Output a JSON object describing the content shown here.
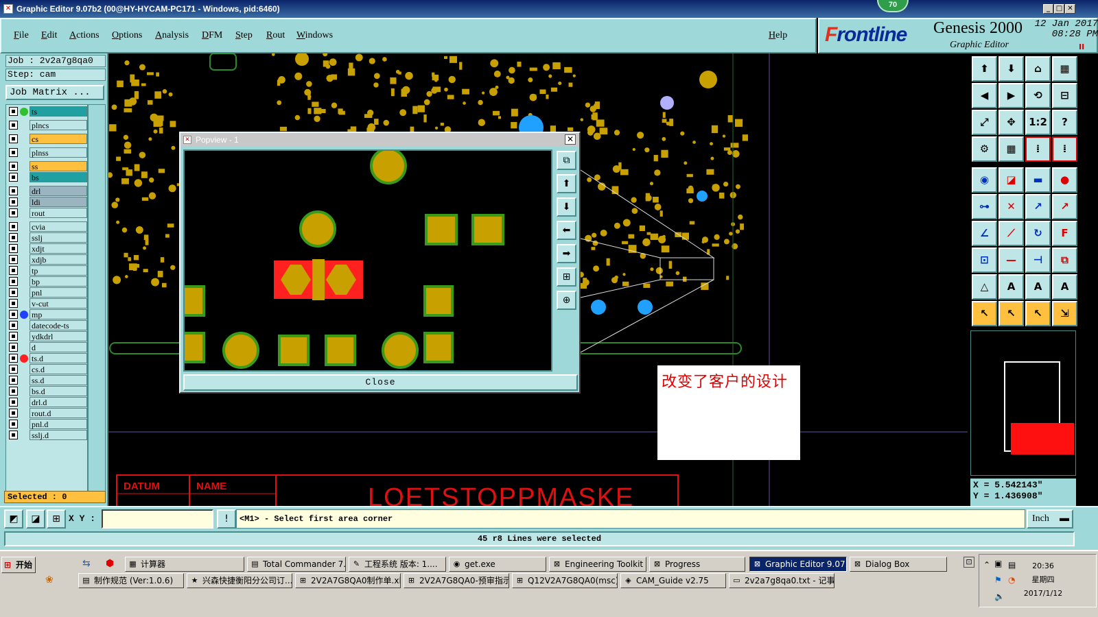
{
  "window": {
    "title": "Graphic Editor 9.07b2 (00@HY-HYCAM-PC171 - Windows, pid:6460)",
    "badge": "70"
  },
  "menu": {
    "items": [
      "File",
      "Edit",
      "Actions",
      "Options",
      "Analysis",
      "DFM",
      "Step",
      "Rout",
      "Windows"
    ],
    "help": "Help"
  },
  "brand": {
    "logo_f": "F",
    "logo_rest": "rontline",
    "title": "Genesis 2000",
    "subtitle": "Graphic Editor",
    "date": "12 Jan 2017",
    "time": "08:28 PM",
    "pause": "II"
  },
  "job": {
    "job": "Job : 2v2a7g8qa0",
    "step": "Step: cam",
    "matrix": "Job Matrix ..."
  },
  "layers": [
    {
      "name": "ts",
      "color": "#20a0a0",
      "dot": "#30c030"
    },
    {
      "name": "plncs",
      "color": "#bfe6e6"
    },
    {
      "name": "cs",
      "color": "#ffc040",
      "mark": "✎"
    },
    {
      "name": "plnss",
      "color": "#bfe6e6"
    },
    {
      "name": "ss",
      "color": "#ffc040",
      "mark": "✎"
    },
    {
      "name": "bs",
      "color": "#20a0a0"
    },
    {
      "name": "drl",
      "color": "#9ab4c0"
    },
    {
      "name": "ldi",
      "color": "#9ab4c0"
    },
    {
      "name": "rout",
      "color": "#bfe6e6"
    },
    {
      "name": "cvia",
      "color": "#bfe6e6"
    },
    {
      "name": "sslj",
      "color": "#bfe6e6",
      "mark": "✎"
    },
    {
      "name": "xdjt",
      "color": "#bfe6e6"
    },
    {
      "name": "xdjb",
      "color": "#bfe6e6"
    },
    {
      "name": "tp",
      "color": "#bfe6e6"
    },
    {
      "name": "bp",
      "color": "#bfe6e6"
    },
    {
      "name": "pnl",
      "color": "#bfe6e6",
      "mark": "✎"
    },
    {
      "name": "v-cut",
      "color": "#bfe6e6"
    },
    {
      "name": "mp",
      "color": "#bfe6e6",
      "dot": "#2040ff"
    },
    {
      "name": "datecode-ts",
      "color": "#bfe6e6"
    },
    {
      "name": "ydkdrl",
      "color": "#bfe6e6"
    },
    {
      "name": "d",
      "color": "#bfe6e6"
    },
    {
      "name": "ts.d",
      "color": "#bfe6e6",
      "dot": "#ff2020",
      "mark": "▪"
    },
    {
      "name": "cs.d",
      "color": "#bfe6e6",
      "mark": "✎"
    },
    {
      "name": "ss.d",
      "color": "#bfe6e6",
      "mark": "✎"
    },
    {
      "name": "bs.d",
      "color": "#bfe6e6"
    },
    {
      "name": "drl.d",
      "color": "#bfe6e6"
    },
    {
      "name": "rout.d",
      "color": "#bfe6e6"
    },
    {
      "name": "pnl.d",
      "color": "#bfe6e6",
      "mark": "✎"
    },
    {
      "name": "sslj.d",
      "color": "#bfe6e6",
      "mark": "✎"
    }
  ],
  "selected": "Selected : 0",
  "popview": {
    "title": "Popview - 1",
    "close": "Close"
  },
  "note": "改变了客户的设计",
  "drawing": {
    "col1": "DATUM",
    "col2": "NAME",
    "big": "LOETSTOPPMASKE"
  },
  "coords": {
    "x": "X = 5.542143\"",
    "y": "Y = 1.436908\""
  },
  "command": {
    "xy_label": "X Y :",
    "prompt": "<M1> - Select first area corner",
    "units": "Inch"
  },
  "status": "45 r8 Lines were selected",
  "taskbar": {
    "start": "开始",
    "row1": [
      {
        "label": "计算器",
        "icon": "▦"
      },
      {
        "label": "Total Commander 7.0 ...",
        "icon": "▤"
      },
      {
        "label": "工程系统  版本: 1....",
        "icon": "✎"
      },
      {
        "label": "get.exe",
        "icon": "◉"
      },
      {
        "label": "Engineering Toolkit 9....",
        "icon": "⊠"
      },
      {
        "label": "Progress",
        "icon": "⊠"
      },
      {
        "label": "Graphic Editor 9.07...",
        "icon": "⊠"
      },
      {
        "label": "Dialog Box",
        "icon": "⊠"
      }
    ],
    "row2": [
      {
        "label": "制作规范 (Ver:1.0.6)",
        "icon": "▤"
      },
      {
        "label": "兴森快捷衡阳分公司订...",
        "icon": "★"
      },
      {
        "label": "2V2A7G8QA0制作单.xls...",
        "icon": "⊞"
      },
      {
        "label": "2V2A7G8QA0-预审指示...",
        "icon": "⊞"
      },
      {
        "label": "Q12V2A7G8QA0(msc).xl...",
        "icon": "⊞"
      },
      {
        "label": "CAM_Guide v2.75",
        "icon": "◈"
      },
      {
        "label": "2v2a7g8qa0.txt - 记事本",
        "icon": "▭"
      }
    ],
    "clock_time": "20:36",
    "clock_day": "星期四",
    "clock_date": "2017/1/12"
  }
}
